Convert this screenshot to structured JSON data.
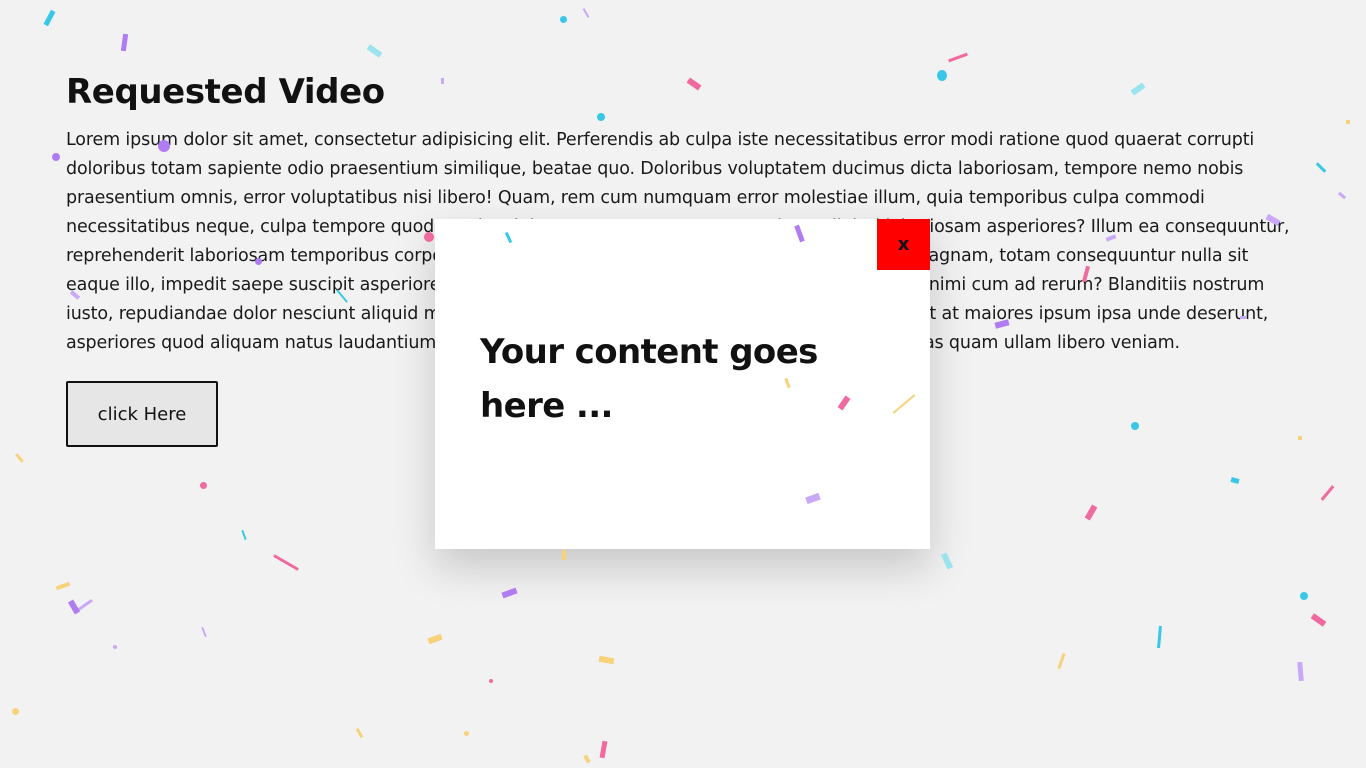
{
  "page": {
    "heading": "Requested Video",
    "paragraph": "Lorem ipsum dolor sit amet, consectetur adipisicing elit. Perferendis ab culpa iste necessitatibus error modi ratione quod quaerat corrupti doloribus totam sapiente odio praesentium similique, beatae quo. Doloribus voluptatem ducimus dicta laboriosam, tempore nemo nobis praesentium omnis, error voluptatibus nisi libero! Quam, rem cum numquam error molestiae illum, quia temporibus culpa commodi necessitatibus neque, culpa tempore quod omnis minima quam error est praesentium adipisci laboriosam asperiores? Illum ea consequuntur, reprehenderit laboriosam temporibus corporis veritatis ullam facilis a, itaque ipsa nostrum? Unde magnam, totam consequuntur nulla sit eaque illo, impedit saepe suscipit asperiores earum hic mollitia quibusdam facere. Doloribus dolor animi cum ad rerum? Blanditiis nostrum iusto, repudiandae dolor nesciunt aliquid magnam quod cum delectus neque sit earum sint deserunt at maiores ipsum ipsa unde deserunt, asperiores quod aliquam natus laudantium in repellat similique alias dicta eaque. Veritatis nemo alias quam ullam libero veniam.",
    "button_label": "click Here"
  },
  "modal": {
    "close_label": "x",
    "content": "Your content goes here ..."
  },
  "colors": {
    "background": "#f2f2f2",
    "close_button": "#ff0000",
    "confetti": [
      "#38c8e6",
      "#b07cf2",
      "#f06aa0",
      "#f7d27a",
      "#9ae3ef",
      "#c9a8f7"
    ]
  }
}
